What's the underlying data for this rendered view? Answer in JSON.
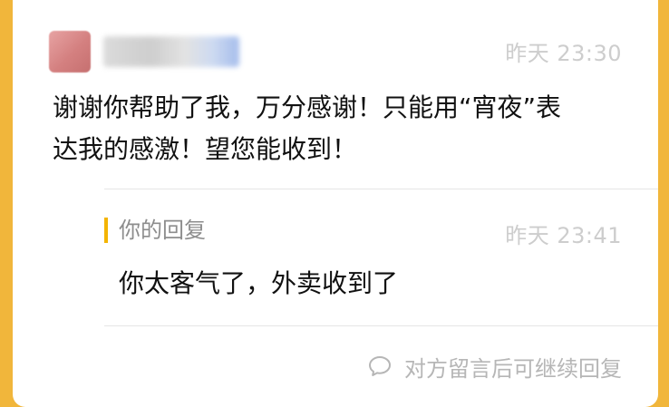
{
  "message": {
    "time": "昨天 23:30",
    "text_line1": "谢谢你帮助了我，万分感谢！只能用“宵夜”表",
    "text_line2": "达我的感激！望您能收到！"
  },
  "reply": {
    "title": "你的回复",
    "time": "昨天 23:41",
    "text": "你太客气了，外卖收到了"
  },
  "footer": {
    "hint": "对方留言后可继续回复",
    "icon": "speech-bubble-icon"
  },
  "colors": {
    "background": "#f1b63b",
    "accent": "#f3b400",
    "muted_text": "#b6b6b6"
  }
}
